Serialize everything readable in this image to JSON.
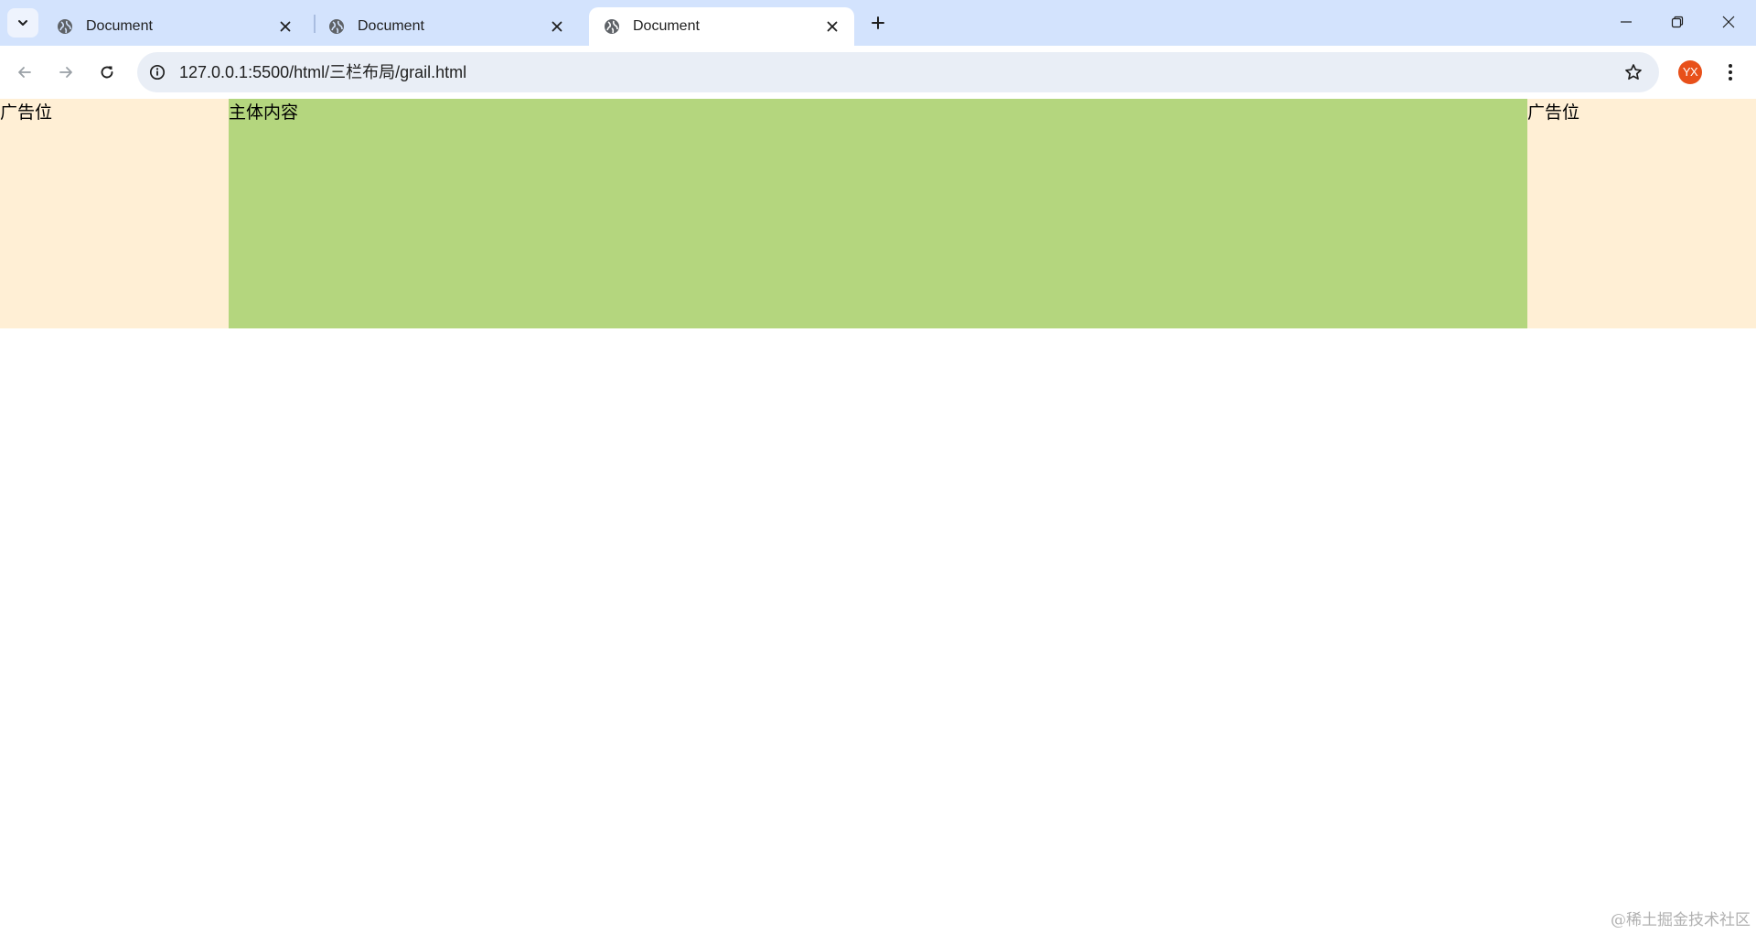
{
  "browser": {
    "tabs": [
      {
        "title": "Document",
        "active": false
      },
      {
        "title": "Document",
        "active": false
      },
      {
        "title": "Document",
        "active": true
      }
    ],
    "url": "127.0.0.1:5500/html/三栏布局/grail.html",
    "profile_initials": "YX",
    "profile_color": "#e8501a",
    "tab_strip_color": "#d3e3fd",
    "omnibox_color": "#e9eef6"
  },
  "page": {
    "left_ad": "广告位",
    "main_content": "主体内容",
    "right_ad": "广告位",
    "side_color": "#ffefd5",
    "main_color": "#b4d67e"
  },
  "watermark": "@稀土掘金技术社区"
}
